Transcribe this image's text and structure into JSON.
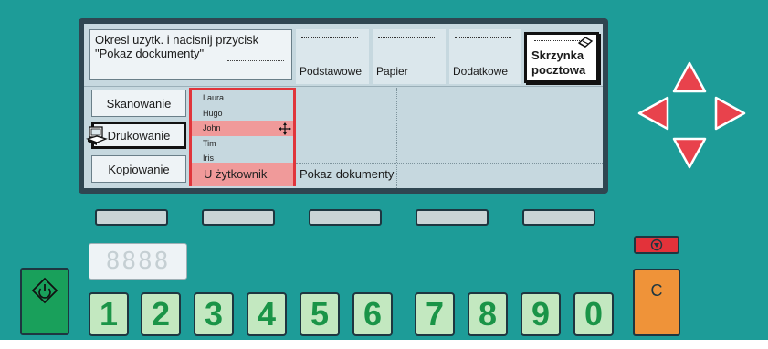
{
  "lcd": {
    "message_line1": "Okresl uzytk. i nacisnij przycisk",
    "message_line2": "\"Pokaz dockumenty\"",
    "tabs": [
      {
        "label": "Podstawowe"
      },
      {
        "label": "Papier"
      },
      {
        "label": "Dodatkowe"
      },
      {
        "label": "Skrzynka pocztowa",
        "selected": true
      }
    ],
    "modes": [
      {
        "label": "Skanowanie"
      },
      {
        "label": "Drukowanie",
        "active": true
      },
      {
        "label": "Kopiowanie"
      }
    ],
    "users": [
      "Laura",
      "Hugo",
      "John",
      "Tim",
      "Iris"
    ],
    "selected_user": "John",
    "user_list_footer": "U żytkownik",
    "show_documents_label": "Pokaz dokumenty"
  },
  "counter": {
    "display": "8888"
  },
  "clear_button": {
    "label": "C"
  },
  "keypad": [
    "1",
    "2",
    "3",
    "4",
    "5",
    "6",
    "7",
    "8",
    "9",
    "0"
  ],
  "colors": {
    "body": "#1d9c98",
    "lcd": "#c6d8df",
    "accent_red": "#e0353b",
    "start_green": "#19a05b",
    "clear_orange": "#ef9339",
    "key_green": "#c3e8c0"
  },
  "icons": {
    "arrows": [
      "arrow-up-icon",
      "arrow-left-icon",
      "arrow-right-icon",
      "arrow-down-icon"
    ],
    "start": "start-icon",
    "stop": "stop-icon",
    "mailbox": "mailbox-icon",
    "printer": "printer-icon",
    "move": "move-cursor-icon"
  }
}
